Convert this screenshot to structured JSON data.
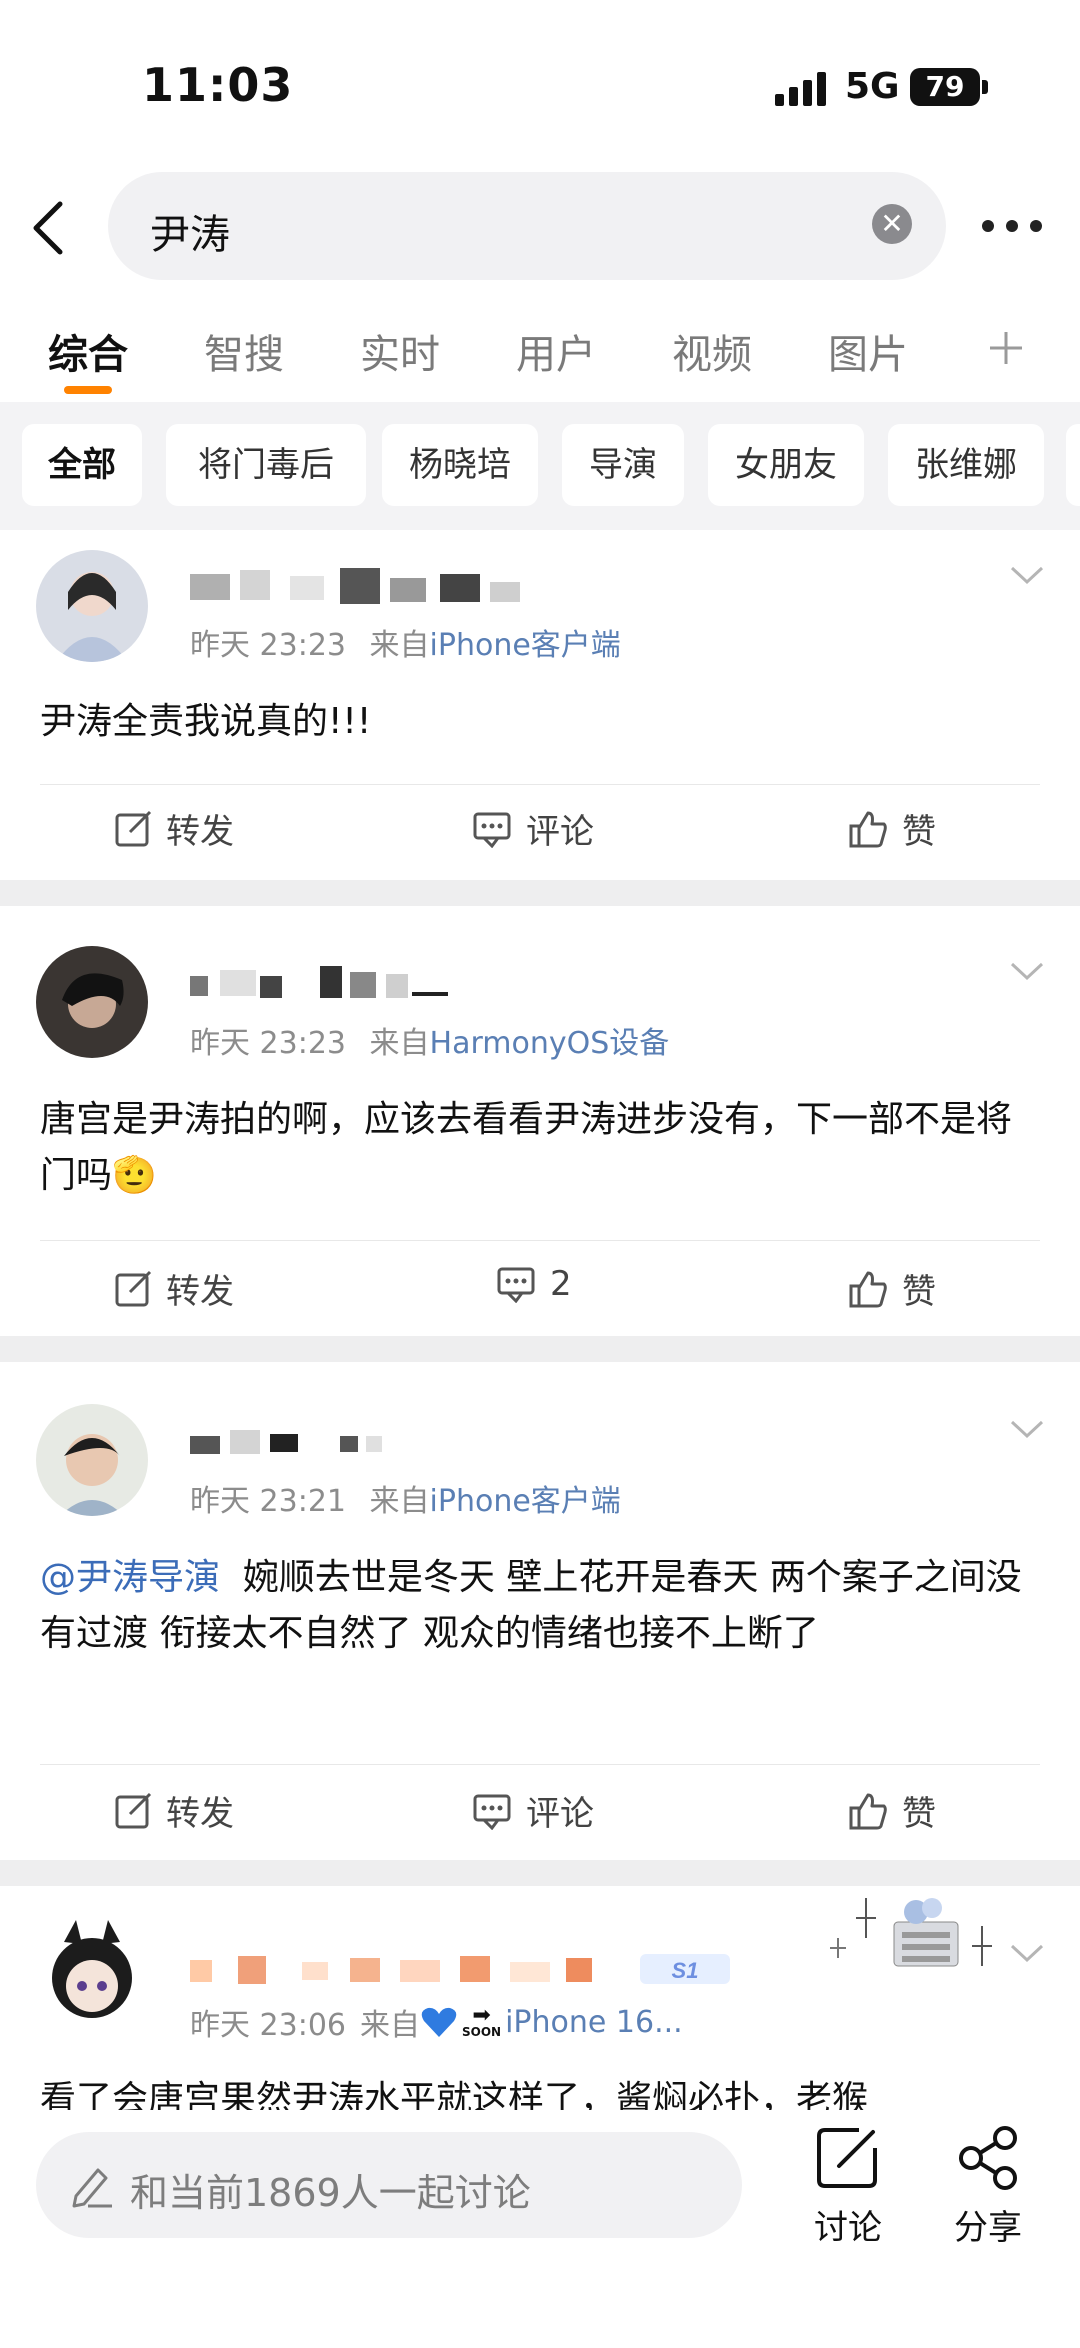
{
  "status": {
    "time": "11:03",
    "network": "5G",
    "battery": "79"
  },
  "search": {
    "query": "尹涛"
  },
  "tabs": [
    "综合",
    "智搜",
    "实时",
    "用户",
    "视频",
    "图片"
  ],
  "chips": [
    "全部",
    "将门毒后",
    "杨晓培",
    "导演",
    "女朋友",
    "张维娜"
  ],
  "posts": [
    {
      "time": "昨天 23:23",
      "from_prefix": "来自",
      "source": "iPhone客户端",
      "text": "尹涛全责我说真的!!!",
      "repost": "转发",
      "comment": "评论",
      "like": "赞"
    },
    {
      "time": "昨天 23:23",
      "from_prefix": "来自",
      "source": "HarmonyOS设备",
      "text": "唐宫是尹涛拍的啊，应该去看看尹涛进步没有，下一部不是将门吗",
      "emoji": "🫡",
      "repost": "转发",
      "comment": "2",
      "like": "赞"
    },
    {
      "time": "昨天 23:21",
      "from_prefix": "来自",
      "source": "iPhone客户端",
      "mention": "@尹涛导演",
      "text": "婉顺去世是冬天 壁上花开是春天 两个案子之间没有过渡 衔接太不自然了 观众的情绪也接不上断了",
      "repost": "转发",
      "comment": "评论",
      "like": "赞"
    },
    {
      "time": "昨天 23:06",
      "from_prefix": "来自",
      "source": "iPhone 16...",
      "soon": "SOON",
      "text": "看了会唐宫果然尹涛水平就这样了，酱焖必扑，老猴"
    }
  ],
  "bottom": {
    "placeholder": "和当前1869人一起讨论",
    "discuss": "讨论",
    "share": "分享"
  },
  "colors": {
    "accent": "#ff8200",
    "link": "#3b6cb8",
    "source": "#5a7fb4"
  }
}
